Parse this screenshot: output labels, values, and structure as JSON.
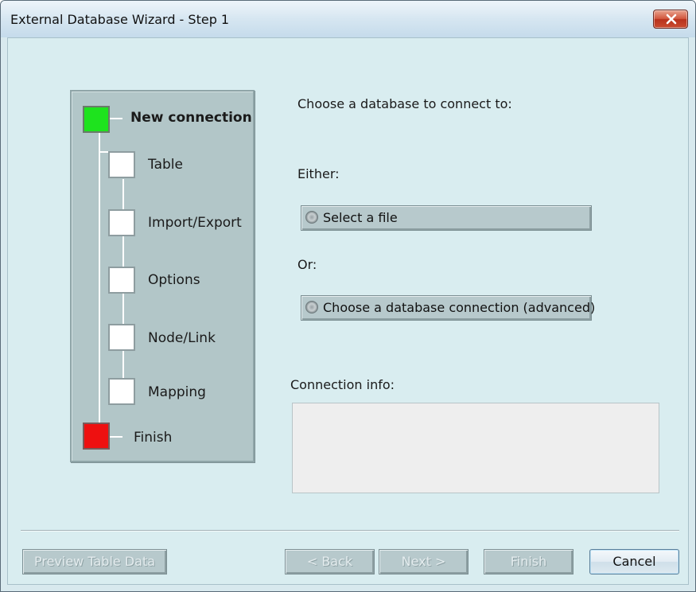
{
  "window": {
    "title": "External Database Wizard - Step 1",
    "close_icon": "close-icon"
  },
  "steps": {
    "items": [
      {
        "label": "New connection",
        "state": "current",
        "color": "#1ee31e"
      },
      {
        "label": "Table",
        "state": "pending"
      },
      {
        "label": "Import/Export",
        "state": "pending"
      },
      {
        "label": "Options",
        "state": "pending"
      },
      {
        "label": "Node/Link",
        "state": "pending"
      },
      {
        "label": "Mapping",
        "state": "pending"
      },
      {
        "label": "Finish",
        "state": "end",
        "color": "#ee1010"
      }
    ]
  },
  "main": {
    "prompt": "Choose a database to connect to:",
    "either_label": "Either:",
    "select_file_label": "Select a file",
    "or_label": "Or:",
    "db_connection_label": "Choose a database connection (advanced)",
    "connection_info_label": "Connection info:",
    "connection_info_value": ""
  },
  "footer": {
    "preview_label": "Preview Table Data",
    "back_label": "< Back",
    "next_label": "Next >",
    "finish_label": "Finish",
    "cancel_label": "Cancel"
  }
}
